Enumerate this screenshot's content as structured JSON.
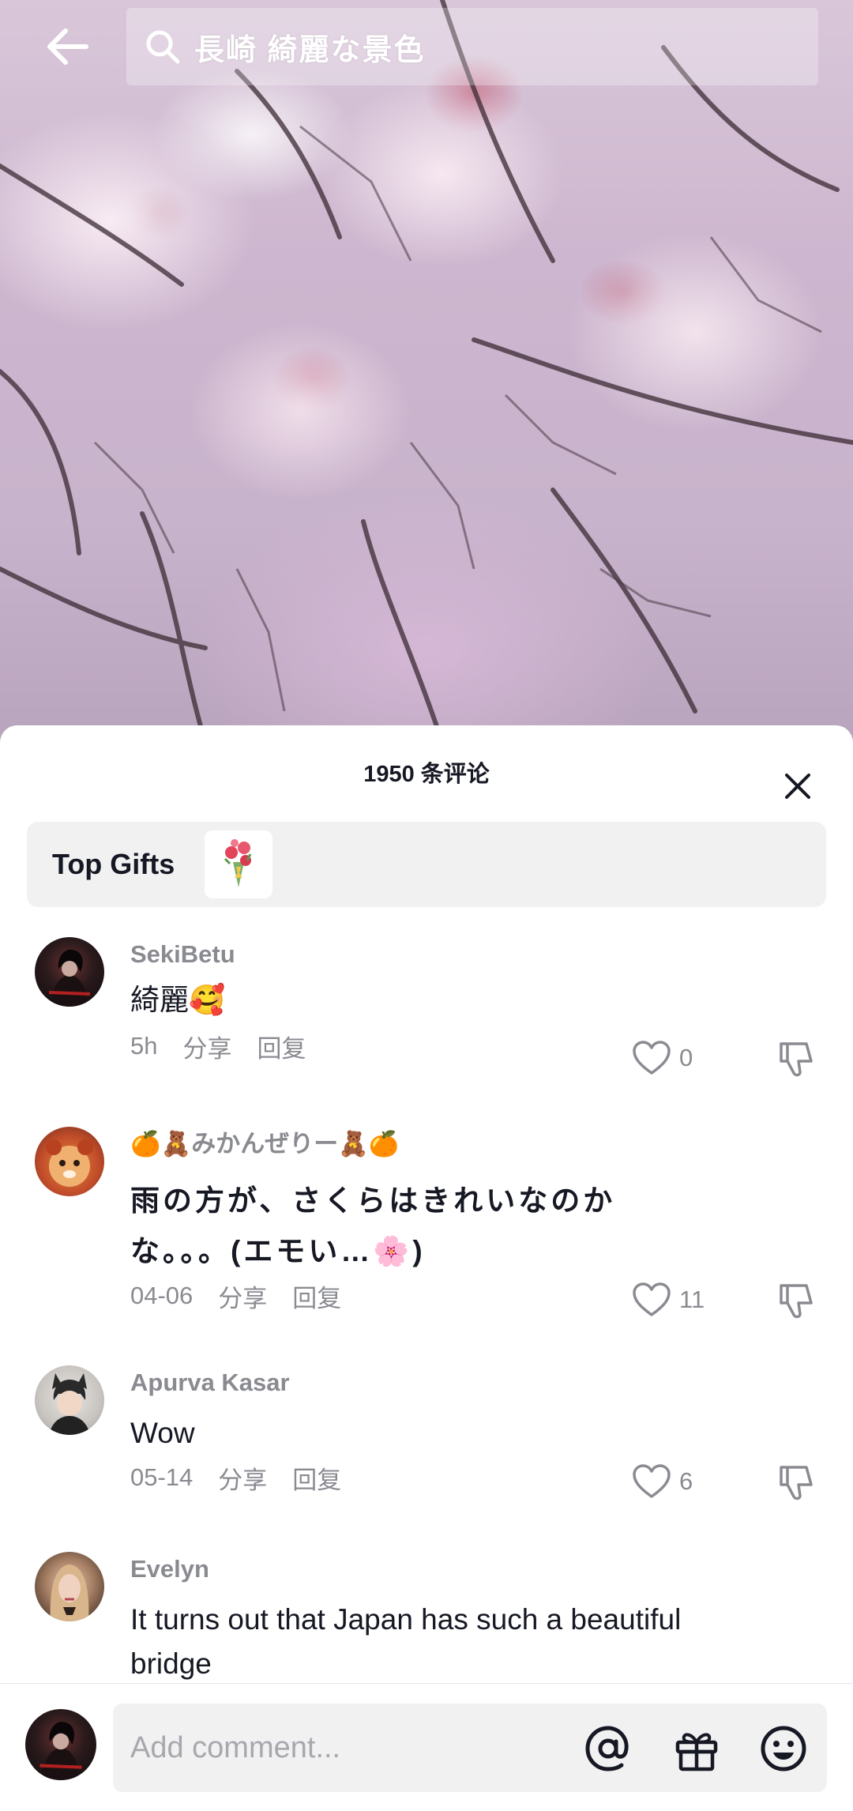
{
  "search": {
    "query": "長崎 綺麗な景色"
  },
  "sheet": {
    "comment_count": "1950 条评论",
    "top_gifts_label": "Top Gifts"
  },
  "comments": [
    {
      "user": "SekiBetu",
      "text": "綺麗🥰",
      "time": "5h",
      "share": "分享",
      "reply": "回复",
      "likes": "0"
    },
    {
      "user": "🍊🧸みかんぜりー🧸🍊",
      "text_line1": "雨の方が、さくらはきれいなのか",
      "text_line2": "な。。。(エモい…🌸)",
      "time": "04-06",
      "share": "分享",
      "reply": "回复",
      "likes": "11"
    },
    {
      "user": "Apurva Kasar",
      "text": "Wow",
      "time": "05-14",
      "share": "分享",
      "reply": "回复",
      "likes": "6"
    },
    {
      "user": "Evelyn",
      "text_line1": "It turns out that Japan has such a beautiful",
      "text_line2": "bridge"
    }
  ],
  "composer": {
    "placeholder": "Add comment..."
  },
  "colors": {
    "text_primary": "#161823",
    "text_secondary": "#8a8b91",
    "sheet_bg": "#ffffff",
    "gift_bar_bg": "#f1f1f2"
  },
  "icons": [
    "back-arrow-icon",
    "search-icon",
    "close-icon",
    "bouquet-icon",
    "heart-icon",
    "thumbs-down-icon",
    "mention-icon",
    "gift-icon",
    "emoji-icon"
  ]
}
